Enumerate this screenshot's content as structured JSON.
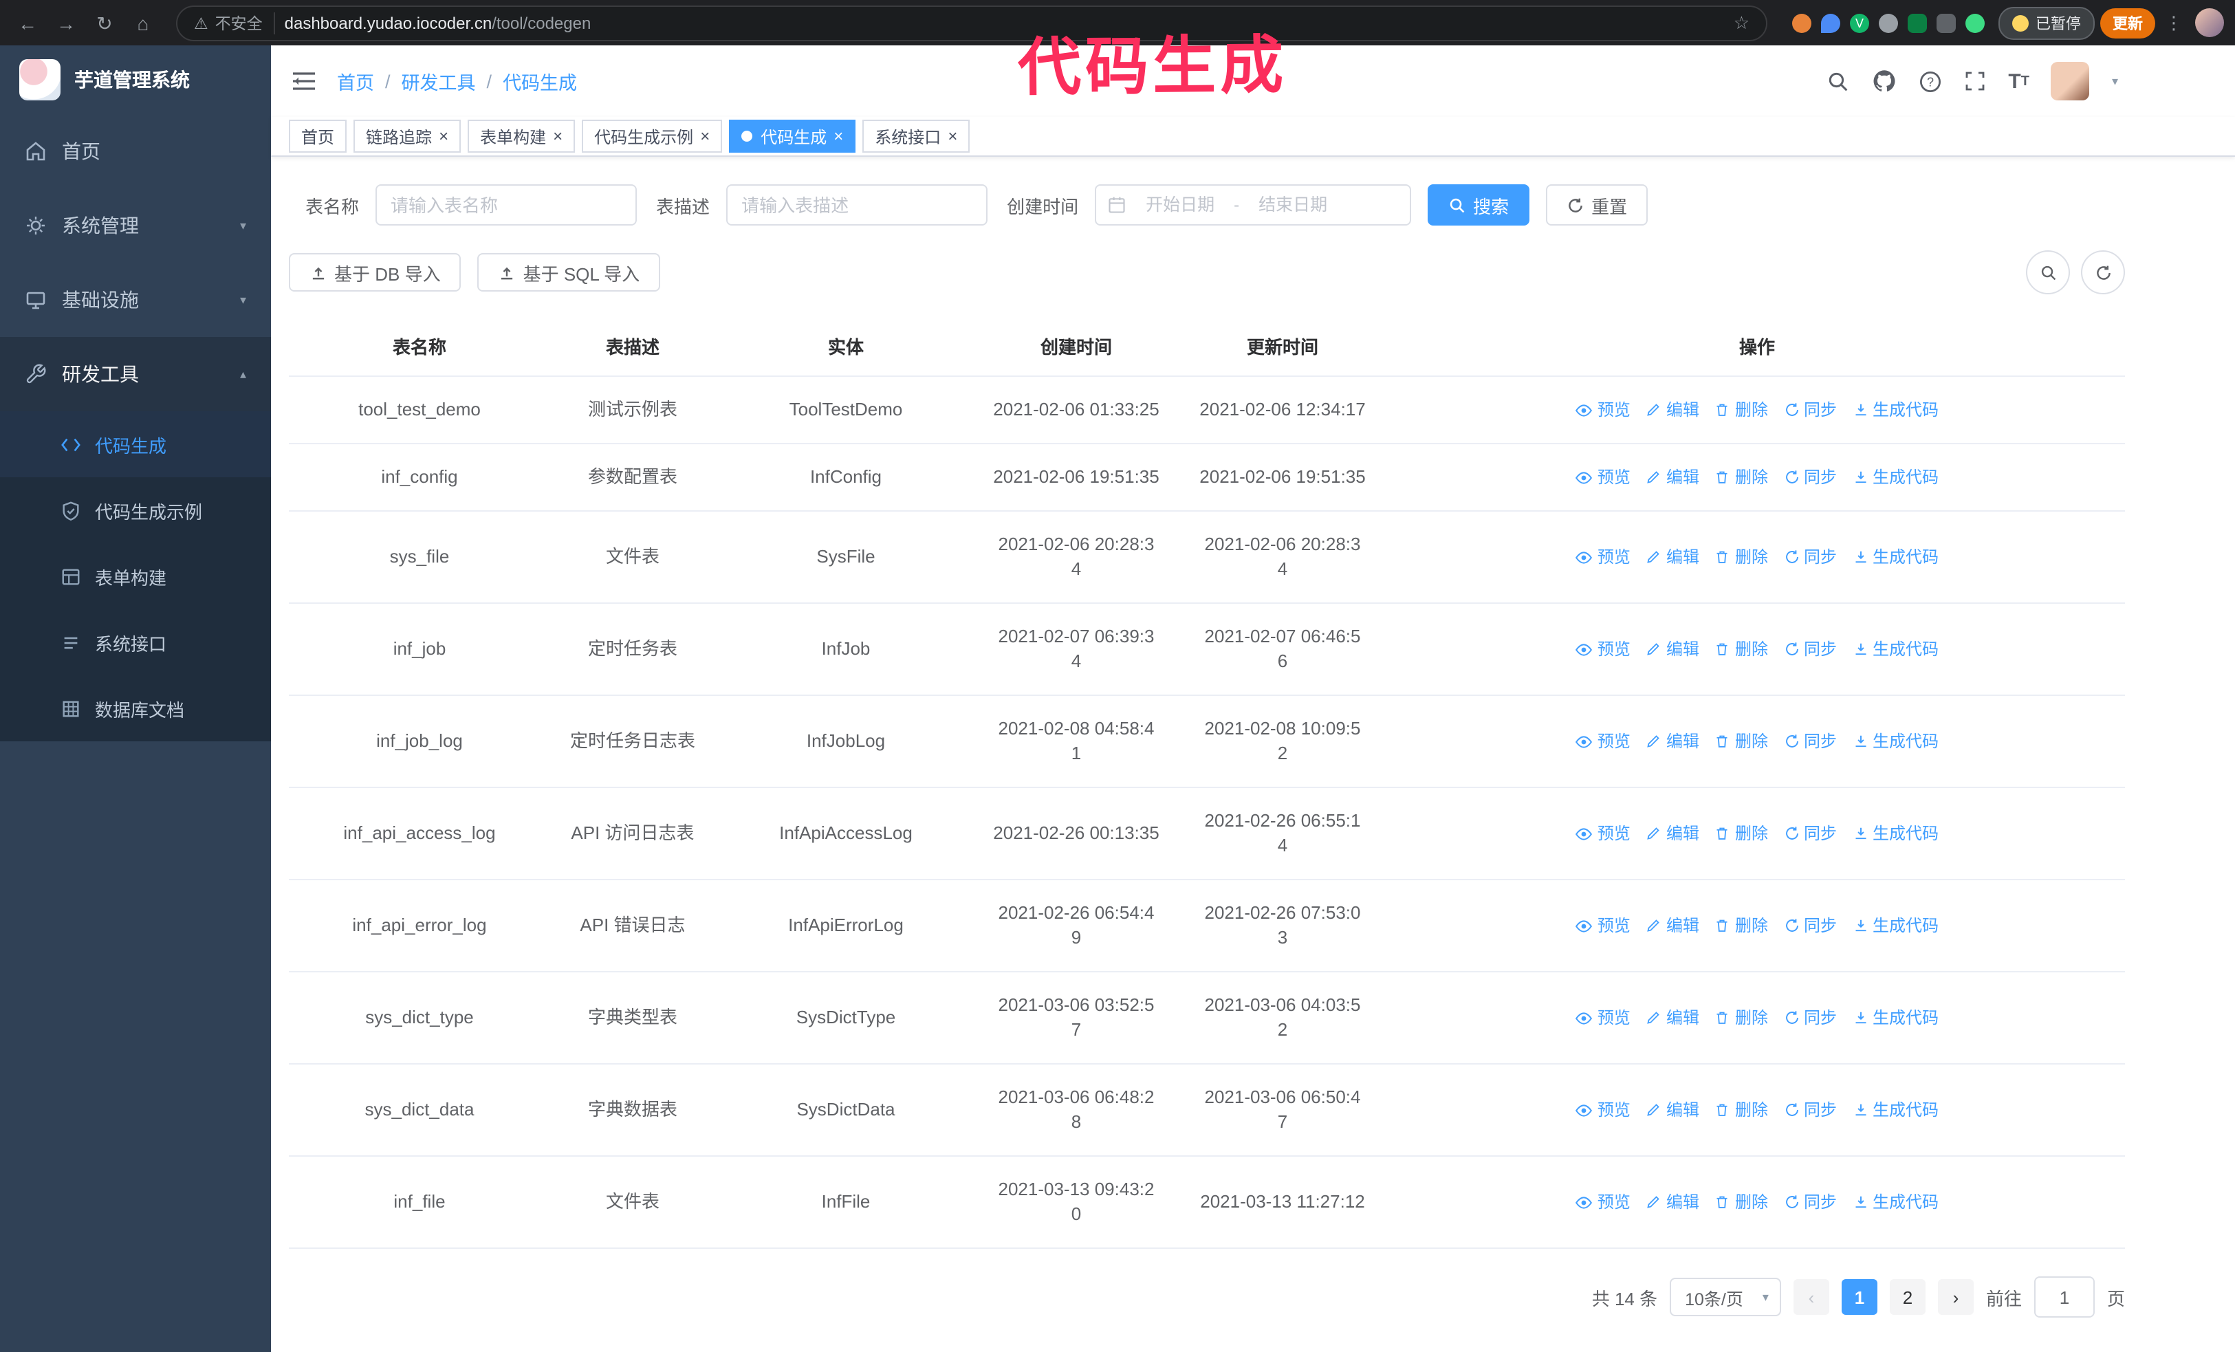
{
  "theme": {
    "primary": "#409eff",
    "annotation_color": "#fb2e5c",
    "sidebar_bg": "#304156"
  },
  "browser": {
    "security_label": "不安全",
    "url_host": "dashboard.yudao.iocoder.cn",
    "url_path": "/tool/codegen",
    "paused_badge": "已暂停",
    "update_button": "更新"
  },
  "annotation": {
    "text": "代码生成"
  },
  "sidebar": {
    "logo_title": "芋道管理系统",
    "items": [
      {
        "label": "首页"
      },
      {
        "label": "系统管理"
      },
      {
        "label": "基础设施"
      },
      {
        "label": "研发工具"
      }
    ],
    "subitems": [
      {
        "label": "代码生成",
        "active": true
      },
      {
        "label": "代码生成示例"
      },
      {
        "label": "表单构建"
      },
      {
        "label": "系统接口"
      },
      {
        "label": "数据库文档"
      }
    ]
  },
  "header": {
    "breadcrumb": [
      "首页",
      "研发工具",
      "代码生成"
    ]
  },
  "tabs": [
    {
      "label": "首页",
      "closable": false,
      "active": false
    },
    {
      "label": "链路追踪",
      "closable": true,
      "active": false
    },
    {
      "label": "表单构建",
      "closable": true,
      "active": false
    },
    {
      "label": "代码生成示例",
      "closable": true,
      "active": false
    },
    {
      "label": "代码生成",
      "closable": true,
      "active": true
    },
    {
      "label": "系统接口",
      "closable": true,
      "active": false
    }
  ],
  "filters": {
    "table_name_label": "表名称",
    "table_name_placeholder": "请输入表名称",
    "table_desc_label": "表描述",
    "table_desc_placeholder": "请输入表描述",
    "create_time_label": "创建时间",
    "date_start_placeholder": "开始日期",
    "date_separator": "-",
    "date_end_placeholder": "结束日期",
    "search_button": "搜索",
    "reset_button": "重置"
  },
  "toolbar": {
    "import_db_button": "基于 DB 导入",
    "import_sql_button": "基于 SQL 导入"
  },
  "table": {
    "headers": [
      "表名称",
      "表描述",
      "实体",
      "创建时间",
      "更新时间",
      "操作"
    ],
    "action_labels": [
      "预览",
      "编辑",
      "删除",
      "同步",
      "生成代码"
    ],
    "rows": [
      {
        "name": "tool_test_demo",
        "desc": "测试示例表",
        "entity": "ToolTestDemo",
        "created": "2021-02-06 01:33:25",
        "updated": "2021-02-06 12:34:17"
      },
      {
        "name": "inf_config",
        "desc": "参数配置表",
        "entity": "InfConfig",
        "created": "2021-02-06 19:51:35",
        "updated": "2021-02-06 19:51:35"
      },
      {
        "name": "sys_file",
        "desc": "文件表",
        "entity": "SysFile",
        "created": "2021-02-06 20:28:3\n4",
        "updated": "2021-02-06 20:28:3\n4"
      },
      {
        "name": "inf_job",
        "desc": "定时任务表",
        "entity": "InfJob",
        "created": "2021-02-07 06:39:3\n4",
        "updated": "2021-02-07 06:46:5\n6"
      },
      {
        "name": "inf_job_log",
        "desc": "定时任务日志表",
        "entity": "InfJobLog",
        "created": "2021-02-08 04:58:4\n1",
        "updated": "2021-02-08 10:09:5\n2"
      },
      {
        "name": "inf_api_access_log",
        "desc": "API 访问日志表",
        "entity": "InfApiAccessLog",
        "created": "2021-02-26 00:13:35",
        "updated": "2021-02-26 06:55:1\n4"
      },
      {
        "name": "inf_api_error_log",
        "desc": "API 错误日志",
        "entity": "InfApiErrorLog",
        "created": "2021-02-26 06:54:4\n9",
        "updated": "2021-02-26 07:53:0\n3"
      },
      {
        "name": "sys_dict_type",
        "desc": "字典类型表",
        "entity": "SysDictType",
        "created": "2021-03-06 03:52:5\n7",
        "updated": "2021-03-06 04:03:5\n2"
      },
      {
        "name": "sys_dict_data",
        "desc": "字典数据表",
        "entity": "SysDictData",
        "created": "2021-03-06 06:48:2\n8",
        "updated": "2021-03-06 06:50:4\n7"
      },
      {
        "name": "inf_file",
        "desc": "文件表",
        "entity": "InfFile",
        "created": "2021-03-13 09:43:2\n0",
        "updated": "2021-03-13 11:27:12"
      }
    ]
  },
  "pagination": {
    "total": "共 14 条",
    "page_size": "10条/页",
    "pages": [
      "1",
      "2"
    ],
    "current": "1",
    "goto_label": "前往",
    "goto_value": "1",
    "page_unit": "页"
  }
}
